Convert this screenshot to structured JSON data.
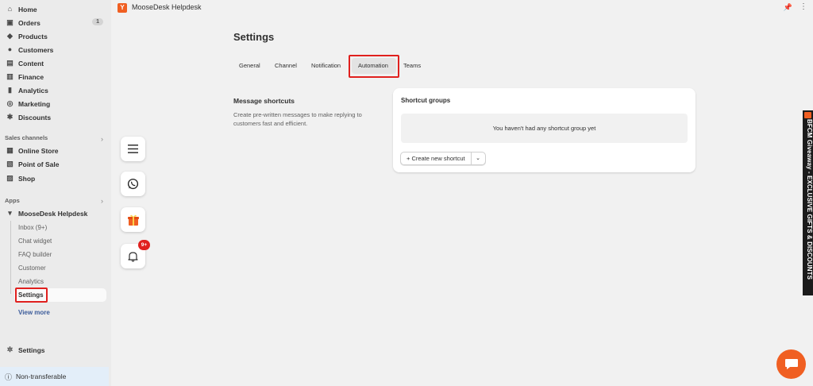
{
  "sidebar": {
    "items": [
      {
        "label": "Home",
        "icon": "home-icon"
      },
      {
        "label": "Orders",
        "icon": "orders-icon",
        "badge": "1"
      },
      {
        "label": "Products",
        "icon": "tag-icon"
      },
      {
        "label": "Customers",
        "icon": "person-icon"
      },
      {
        "label": "Content",
        "icon": "content-icon"
      },
      {
        "label": "Finance",
        "icon": "bank-icon"
      },
      {
        "label": "Analytics",
        "icon": "bar-chart-icon"
      },
      {
        "label": "Marketing",
        "icon": "target-icon"
      },
      {
        "label": "Discounts",
        "icon": "discount-icon"
      }
    ],
    "sales_channels_header": "Sales channels",
    "sales_channels": [
      {
        "label": "Online Store",
        "icon": "store-icon"
      },
      {
        "label": "Point of Sale",
        "icon": "pos-icon"
      },
      {
        "label": "Shop",
        "icon": "shop-icon"
      }
    ],
    "apps_header": "Apps",
    "app_name": "MooseDesk Helpdesk",
    "app_sub_items": [
      "Inbox (9+)",
      "Chat widget",
      "FAQ builder",
      "Customer",
      "Analytics",
      "Settings"
    ],
    "view_more": "View more",
    "settings_label": "Settings",
    "footer_label": "Non-transferable"
  },
  "topbar": {
    "title": "MooseDesk Helpdesk",
    "logo_letter": "Y"
  },
  "main": {
    "page_title": "Settings",
    "tabs": [
      "General",
      "Channel",
      "Notification",
      "Automation",
      "Teams"
    ],
    "active_tab": "Automation",
    "section_title": "Message shortcuts",
    "section_desc": "Create pre-written messages to make replying to customers fast and efficient.",
    "card_title": "Shortcut groups",
    "empty_text": "You haven't had any shortcut group yet",
    "create_button": "+ Create new shortcut"
  },
  "floating": {
    "notification_badge": "9+"
  },
  "promo": {
    "text": "BFCM Giveaway - EXCLUSIVE GIFTS & DISCOUNTS"
  },
  "colors": {
    "accent": "#f05f22",
    "highlight": "#e0201e",
    "sidebar_bg": "#ebebeb",
    "page_bg": "#f1f1f1"
  }
}
